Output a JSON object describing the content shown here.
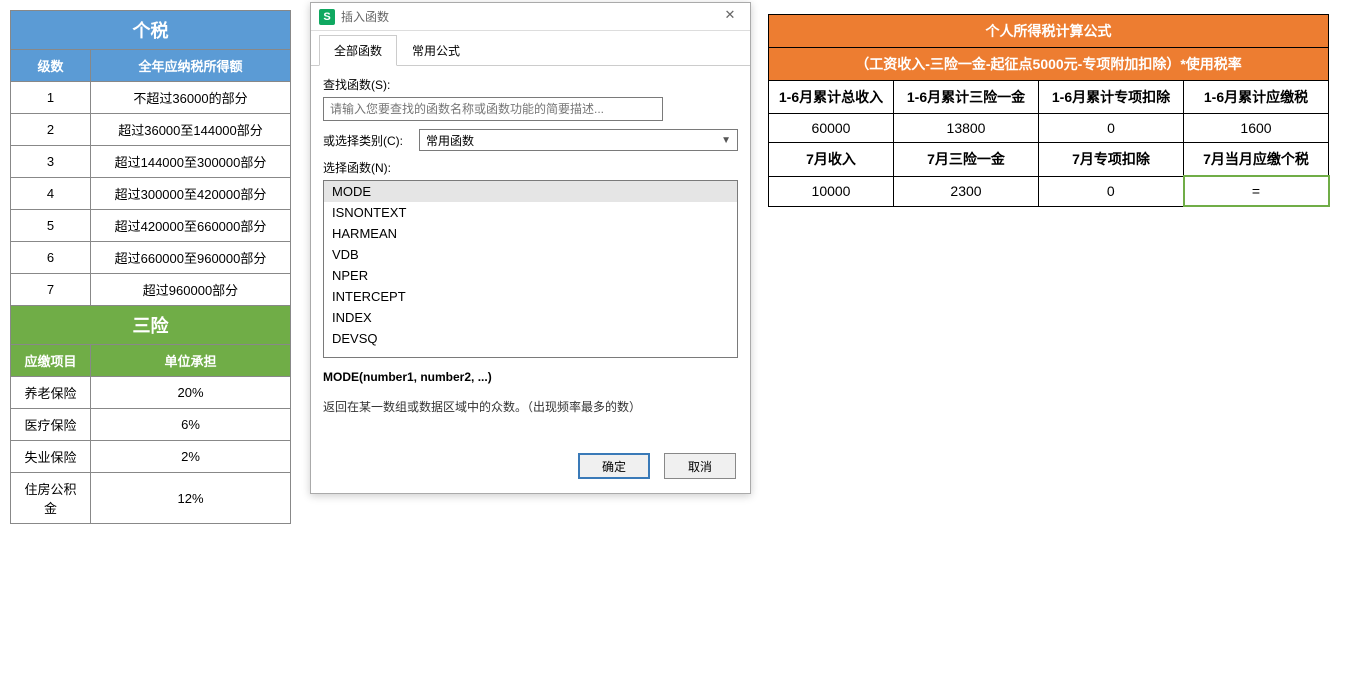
{
  "tax": {
    "title": "个税",
    "headers": {
      "level": "级数",
      "range": "全年应纳税所得额"
    },
    "rows": [
      {
        "level": "1",
        "range": "不超过36000的部分"
      },
      {
        "level": "2",
        "range": "超过36000至144000部分"
      },
      {
        "level": "3",
        "range": "超过144000至300000部分"
      },
      {
        "level": "4",
        "range": "超过300000至420000部分"
      },
      {
        "level": "5",
        "range": "超过420000至660000部分"
      },
      {
        "level": "6",
        "range": "超过660000至960000部分"
      },
      {
        "level": "7",
        "range": "超过960000部分"
      }
    ]
  },
  "insurance": {
    "title": "三险",
    "headers": {
      "item": "应缴项目",
      "company": "单位承担"
    },
    "rows": [
      {
        "item": "养老保险",
        "company": "20%"
      },
      {
        "item": "医疗保险",
        "company": "6%"
      },
      {
        "item": "失业保险",
        "company": "2%"
      },
      {
        "item": "住房公积金",
        "company": "12%"
      }
    ]
  },
  "calc": {
    "title": "个人所得税计算公式",
    "subtitle": "（工资收入-三险一金-起征点5000元-专项附加扣除）*使用税率",
    "row1h": [
      "1-6月累计总收入",
      "1-6月累计三险一金",
      "1-6月累计专项扣除",
      "1-6月累计应缴税"
    ],
    "row1v": [
      "60000",
      "13800",
      "0",
      "1600"
    ],
    "row2h": [
      "7月收入",
      "7月三险一金",
      "7月专项扣除",
      "7月当月应缴个税"
    ],
    "row2v": [
      "10000",
      "2300",
      "0",
      "="
    ]
  },
  "dialog": {
    "title": "插入函数",
    "tabs": {
      "all": "全部函数",
      "common": "常用公式"
    },
    "searchLabel": "查找函数(S):",
    "searchPlaceholder": "请输入您要查找的函数名称或函数功能的简要描述...",
    "catLabel": "或选择类别(C):",
    "catValue": "常用函数",
    "selectLabel": "选择函数(N):",
    "functions": [
      "MODE",
      "ISNONTEXT",
      "HARMEAN",
      "VDB",
      "NPER",
      "INTERCEPT",
      "INDEX",
      "DEVSQ"
    ],
    "signature": "MODE(number1, number2, ...)",
    "description": "返回在某一数组或数据区域中的众数。（出现频率最多的数）",
    "ok": "确定",
    "cancel": "取消"
  },
  "colors": {
    "blue": "#5b9bd5",
    "green": "#70ad47",
    "orange": "#ed7d31"
  }
}
